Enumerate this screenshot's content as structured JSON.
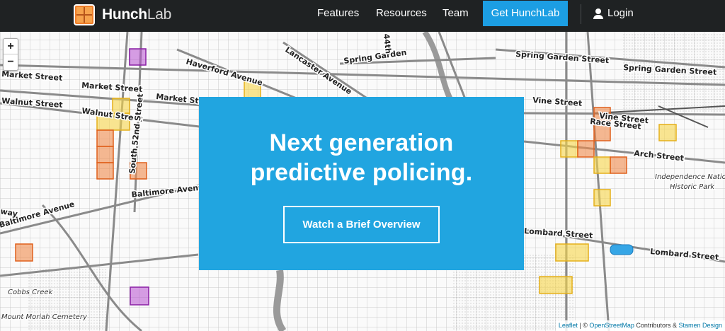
{
  "navbar": {
    "brand_strong": "Hunch",
    "brand_light": "Lab",
    "links": [
      "Features",
      "Resources",
      "Team"
    ],
    "cta": "Get HunchLab",
    "login": "Login"
  },
  "hero": {
    "line1": "Next generation",
    "line2": "predictive policing.",
    "button": "Watch a Brief Overview"
  },
  "zoom": {
    "in": "+",
    "out": "−"
  },
  "attribution": {
    "leaflet": "Leaflet",
    "sep1": " | © ",
    "osm": "OpenStreetMap",
    "contributors": " Contributors & ",
    "stamen": "Stamen Design"
  },
  "map": {
    "street_labels": [
      "Market Street",
      "Market Street",
      "Market Street",
      "Walnut Street",
      "Walnut Street",
      "Haverford Avenue",
      "Lancaster Avenue",
      "Spring Garden",
      "Spring Garden Street",
      "Spring Garden Street",
      "Vine Street",
      "Vine Street",
      "Race Street",
      "Arch Street",
      "South 52nd Street",
      "Baltimore Avenue",
      "Baltimore Avenue",
      "Lombard Street",
      "Lombard Street",
      "way",
      "44th"
    ],
    "area_labels": [
      "Independence National",
      "Historic Park",
      "Cobbs Creek",
      "Mount Moriah Cemetery"
    ]
  },
  "colors": {
    "navbar": "#1f2223",
    "accent_blue": "#21a5e0",
    "cta_blue": "#1c9ee3",
    "cell_yellow": "#f7d64a",
    "cell_orange": "#f08a4b",
    "cell_purple": "#b64fcf"
  },
  "icons": [
    "user-icon",
    "logo-icon",
    "zoom-in-icon",
    "zoom-out-icon"
  ]
}
